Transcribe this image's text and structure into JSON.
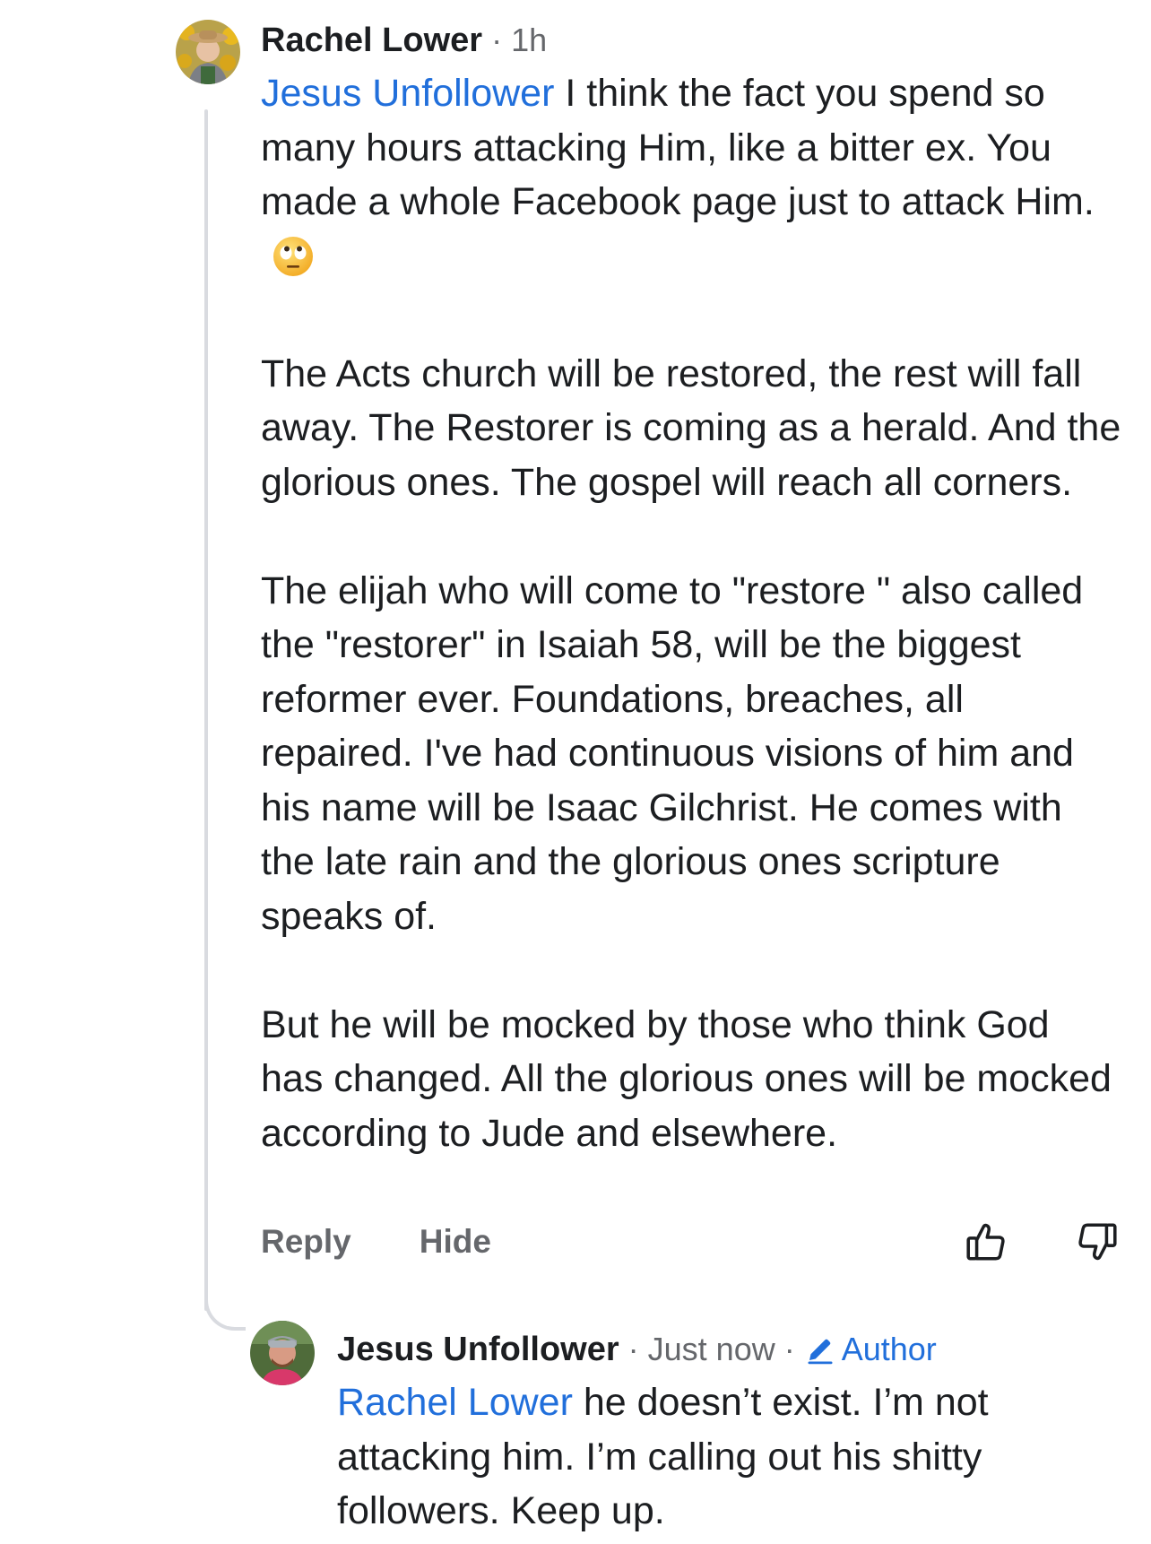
{
  "comments": [
    {
      "author": "Rachel Lower",
      "time": "1h",
      "avatar_icon": "profile-photo-rachel",
      "mention": "Jesus Unfollower",
      "p1_text": " I think the fact you spend so many hours attacking Him, like a bitter ex. You made a whole Facebook page just to attack Him.",
      "p1_emoji": "eye-roll-emoji",
      "paragraphs": [
        "The Acts church will be restored,  the rest will fall away. The Restorer is coming as a herald. And the glorious ones. The gospel will reach all corners.",
        "The elijah who will come to \"restore \" also called the \"restorer\" in Isaiah 58, will be the biggest reformer ever. Foundations, breaches, all repaired.  I've had continuous visions of him and his name will be Isaac Gilchrist. He comes with the late rain and the glorious ones scripture speaks of.",
        "But he will be mocked by those who think God has changed. All the glorious ones will be mocked according to Jude and elsewhere."
      ],
      "actions": {
        "reply_label": "Reply",
        "hide_label": "Hide",
        "upvote_icon": "thumbs-up-icon",
        "downvote_icon": "thumbs-down-icon"
      }
    },
    {
      "author": "Jesus Unfollower",
      "time": "Just now",
      "badge": "Author",
      "badge_icon": "pencil-icon",
      "avatar_icon": "profile-photo-jesus-unfollower",
      "mention": "Rachel Lower",
      "text": " he doesn’t exist. I’m not attacking him. I’m calling out his shitty followers. Keep up."
    }
  ],
  "separator": "·",
  "colors": {
    "link": "#216fdb",
    "meta": "#65676b",
    "text": "#1c1e21",
    "thread_line": "#d9dbe0"
  }
}
